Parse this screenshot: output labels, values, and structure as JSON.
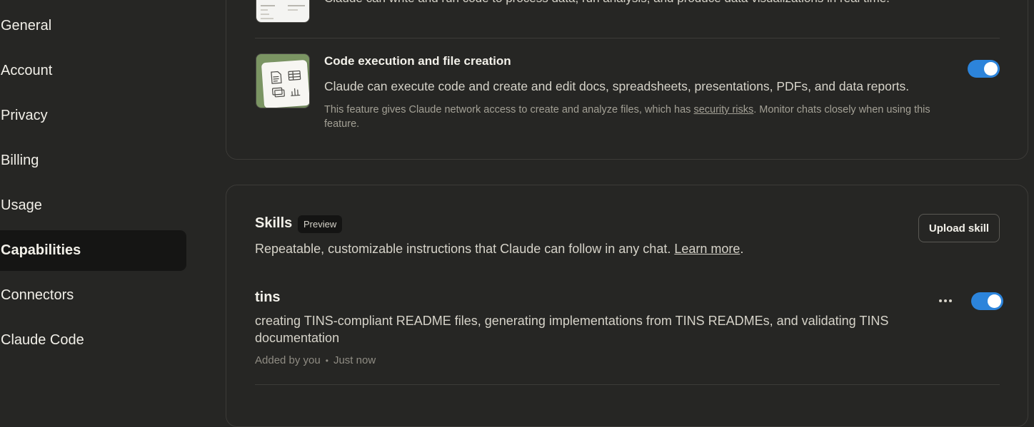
{
  "sidebar": {
    "items": [
      {
        "label": "General",
        "active": false
      },
      {
        "label": "Account",
        "active": false
      },
      {
        "label": "Privacy",
        "active": false
      },
      {
        "label": "Billing",
        "active": false
      },
      {
        "label": "Usage",
        "active": false
      },
      {
        "label": "Capabilities",
        "active": true
      },
      {
        "label": "Connectors",
        "active": false
      },
      {
        "label": "Claude Code",
        "active": false
      }
    ]
  },
  "features": {
    "analysis_desc": "Claude can write and run code to process data, run analysis, and produce data visualizations in real time.",
    "code_execution": {
      "title": "Code execution and file creation",
      "description": "Claude can execute code and create and edit docs, spreadsheets, presentations, PDFs, and data reports.",
      "note_before": "This feature gives Claude network access to create and analyze files, which has ",
      "note_link": "security risks",
      "note_after": ". Monitor chats closely when using this feature.",
      "enabled": true
    }
  },
  "skills": {
    "title": "Skills",
    "badge": "Preview",
    "description": "Repeatable, customizable instructions that Claude can follow in any chat. ",
    "learn_more": "Learn more",
    "desc_end": ".",
    "upload_label": "Upload skill",
    "items": [
      {
        "name": "tins",
        "description": "creating TINS-compliant README files, generating implementations from TINS READMEs, and validating TINS documentation",
        "added_by": "Added by you",
        "separator": "•",
        "time": "Just now",
        "enabled": true
      }
    ]
  },
  "icons": {
    "more": "more-horizontal-icon"
  },
  "colors": {
    "background": "#262624",
    "toggle_on": "#2c84db",
    "active_nav": "#151514"
  }
}
